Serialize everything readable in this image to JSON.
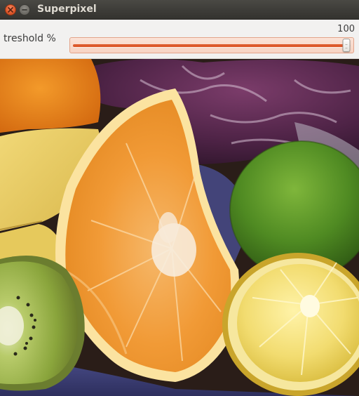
{
  "window": {
    "title": "Superpixel"
  },
  "trackbar": {
    "label": "treshold %",
    "value": "100",
    "value_fraction": 1.0
  },
  "icons": {
    "close": "close-icon",
    "minimize": "minimize-icon"
  },
  "colors": {
    "slider_accent": "#dd5a2c",
    "titlebar": "#3c3b37",
    "close_button": "#e0582b"
  }
}
